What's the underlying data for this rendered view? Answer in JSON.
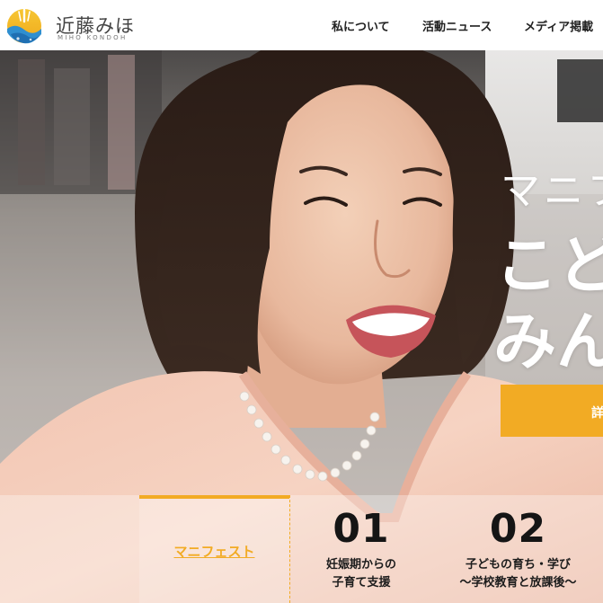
{
  "header": {
    "logo": {
      "name": "近藤みほ",
      "subtitle": "MIHO KONDOH"
    },
    "nav": [
      {
        "label": "私について"
      },
      {
        "label": "活動ニュース"
      },
      {
        "label": "メディア掲載"
      }
    ]
  },
  "hero": {
    "line1": "マニフ",
    "line2": "こど",
    "line3": "みん",
    "cta_label": "詳"
  },
  "tabs": {
    "manifest": {
      "label": "マニフェスト"
    },
    "items": [
      {
        "number": "01",
        "line1": "妊娠期からの",
        "line2": "子育て支援"
      },
      {
        "number": "02",
        "line1": "子どもの育ち・学び",
        "line2": "～学校教育と放課後～"
      }
    ]
  },
  "colors": {
    "accent": "#f2ab24",
    "text": "#1c1c1c",
    "logo_blue": "#2f8fd0",
    "logo_yellow": "#f2c230"
  }
}
